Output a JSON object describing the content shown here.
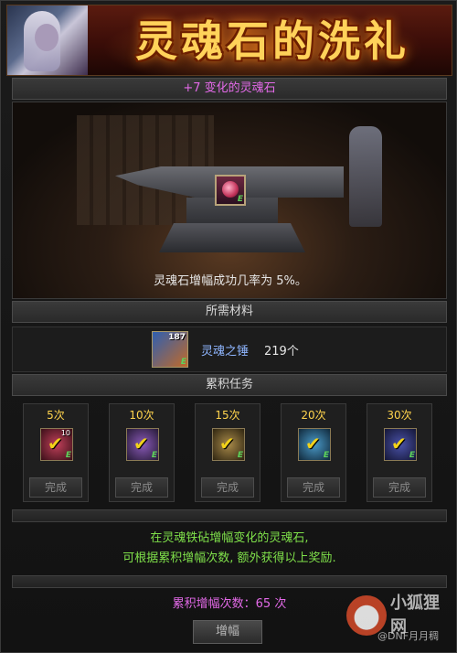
{
  "banner": {
    "title": "灵魂石的洗礼"
  },
  "upgrade_header": "+7 变化的灵魂石",
  "forge": {
    "success_rate_text": "灵魂石增幅成功几率为 5%。"
  },
  "materials": {
    "header": "所需材料",
    "item": {
      "name": "灵魂之锤",
      "quantity": "219个",
      "stack_count": "187",
      "grade": "E"
    }
  },
  "tasks": {
    "header": "累积任务",
    "items": [
      {
        "count": "5次",
        "button": "完成",
        "badge": "10",
        "grade": "E",
        "icon_color": "#7a1f2a"
      },
      {
        "count": "10次",
        "button": "完成",
        "grade": "E",
        "icon_color": "#5a3a7a"
      },
      {
        "count": "15次",
        "button": "完成",
        "grade": "E",
        "icon_color": "#6b5a2a"
      },
      {
        "count": "20次",
        "button": "完成",
        "grade": "E",
        "icon_color": "#2a5a7a"
      },
      {
        "count": "30次",
        "button": "完成",
        "grade": "E",
        "icon_color": "#2a2f6a"
      }
    ]
  },
  "notice": {
    "line1": "在灵魂铁砧增幅变化的灵魂石,",
    "line2": "可根据累积增幅次数, 额外获得以上奖励."
  },
  "total_text": "累积增幅次数：65 次",
  "boost_button": "增幅",
  "watermark": {
    "brand": "小狐狸网",
    "sub": "@DNF月月稠"
  }
}
